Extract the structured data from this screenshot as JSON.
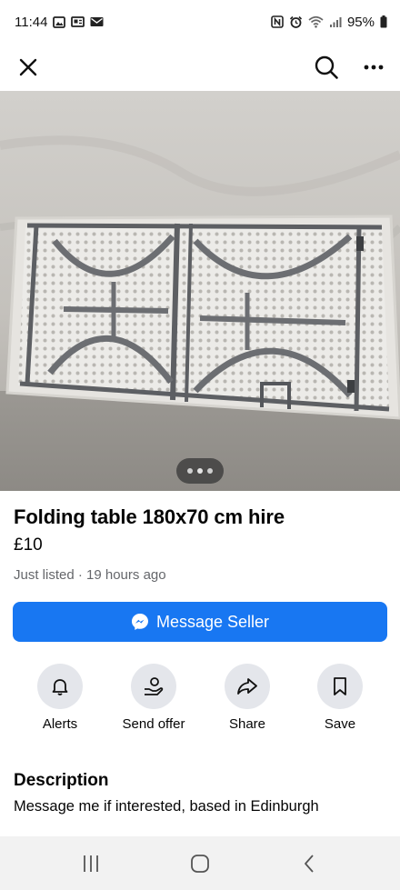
{
  "status_bar": {
    "time": "11:44",
    "battery": "95%",
    "left_icons": [
      "gallery-icon",
      "news-icon",
      "mail-icon"
    ],
    "right_icons": [
      "nfc-icon",
      "alarm-icon",
      "wifi-icon",
      "signal-icon",
      "battery-icon"
    ]
  },
  "nav": {
    "close_icon": "close-icon",
    "search_icon": "search-icon",
    "more_icon": "more-icon"
  },
  "gallery": {
    "image_index_dots": 3,
    "current": 2
  },
  "listing": {
    "title": "Folding table 180x70 cm hire",
    "price": "£10",
    "meta": "Just listed · 19 hours ago"
  },
  "message_button": {
    "label": "Message Seller",
    "icon": "messenger-icon"
  },
  "actions": [
    {
      "label": "Alerts",
      "icon": "bell-icon"
    },
    {
      "label": "Send offer",
      "icon": "offer-icon"
    },
    {
      "label": "Share",
      "icon": "share-icon"
    },
    {
      "label": "Save",
      "icon": "bookmark-icon"
    }
  ],
  "description": {
    "heading": "Description",
    "text": "Message me if interested, based in Edinburgh"
  },
  "system_nav": [
    "recents-icon",
    "home-icon",
    "back-icon"
  ],
  "colors": {
    "accent": "#1877f2",
    "secondary_text": "#65676b",
    "action_circle": "#e4e6eb"
  }
}
